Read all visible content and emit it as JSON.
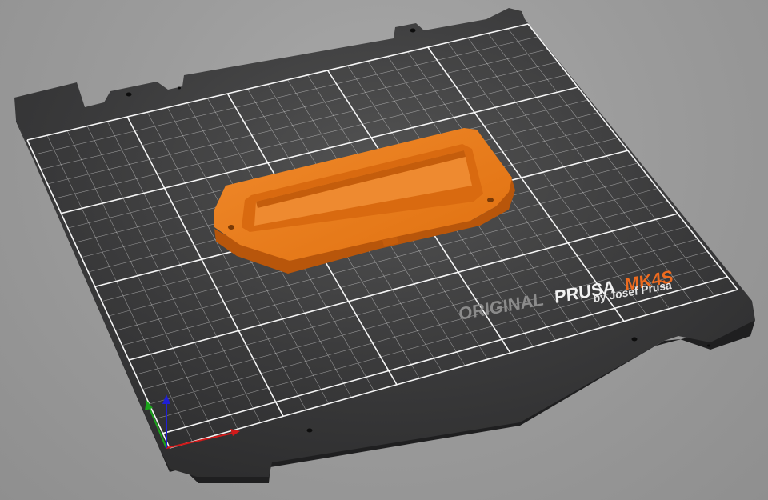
{
  "viewport": {
    "background_color": "#9c9c9c"
  },
  "bed": {
    "sheet_color": "#2f2f30",
    "grid_color": "#ffffff",
    "brand_original": "ORIGINAL",
    "brand_prusa": "PRUSA",
    "brand_model": "MK4S",
    "brand_sub": "by Josef Prusa",
    "brand_original_color": "#8b8b8b",
    "brand_prusa_color": "#f2f2f2",
    "brand_model_color": "#ee6b1f"
  },
  "model": {
    "color": "#e87312",
    "shadow_color": "#b5520a"
  },
  "axes": {
    "x_color": "#d11a1a",
    "y_color": "#1aa51a",
    "z_color": "#1f1fd6"
  }
}
